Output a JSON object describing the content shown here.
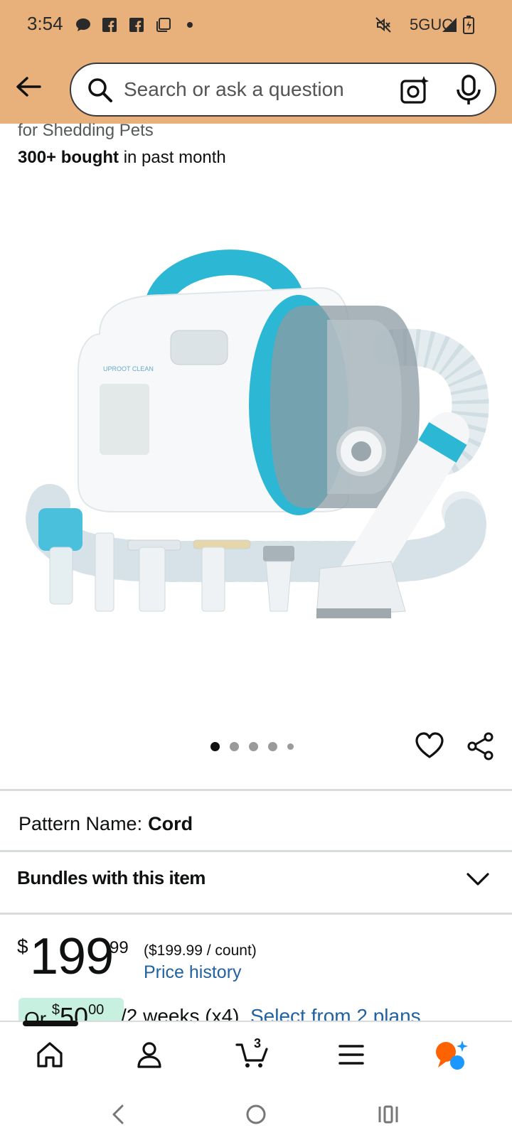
{
  "status_bar": {
    "time": "3:54",
    "network": "5GUC",
    "icons": [
      "message-icon",
      "facebook-icon",
      "facebook-icon",
      "screenshot-icon",
      "dot-icon",
      "mute-icon",
      "signal-icon",
      "battery-icon"
    ]
  },
  "header": {
    "back_icon": "back-arrow-icon",
    "search_placeholder": "Search or ask a question",
    "camera_icon": "camera-search-icon",
    "mic_icon": "microphone-icon"
  },
  "product": {
    "title_tail": "for Shedding Pets",
    "bought_bold": "300+ bought",
    "bought_rest": " in past month",
    "image_dots": 5,
    "active_dot": 0
  },
  "pattern": {
    "label": "Pattern Name:",
    "value": "Cord"
  },
  "bundles": {
    "label": "Bundles with this item"
  },
  "price": {
    "currency": "$",
    "whole": "199",
    "fraction": "99",
    "unit_price": "($199.99 / count)",
    "history_link": "Price history"
  },
  "installment": {
    "or": "Or ",
    "currency": "$",
    "whole": "50",
    "fraction": "00",
    "terms": "/2 weeks (x4)",
    "plans_link": "Select from 2 plans"
  },
  "bottom_nav": {
    "items": [
      "home-icon",
      "account-icon",
      "cart-icon",
      "menu-icon",
      "rufus-icon"
    ],
    "cart_count": "3",
    "active_index": 0
  },
  "system_nav": [
    "back-nav-icon",
    "home-nav-icon",
    "recents-nav-icon"
  ],
  "colors": {
    "header_bg": "#e8b07a",
    "link": "#2162a1",
    "installment_bg": "#c7f0e0",
    "accent_orange": "#ff6200",
    "accent_blue": "#1a98ff"
  }
}
